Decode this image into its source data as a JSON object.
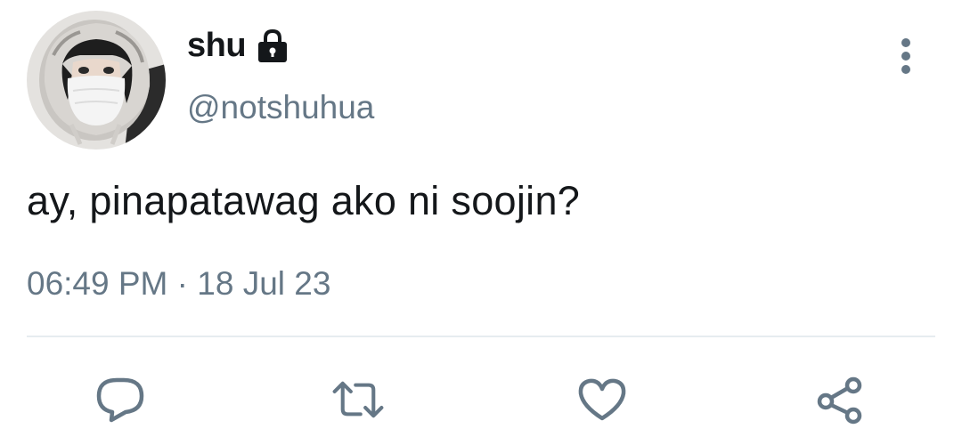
{
  "user": {
    "display_name": "shu",
    "handle": "@notshuhua",
    "protected": true,
    "avatar_icon": "profile-photo-masked-person"
  },
  "tweet": {
    "text": "ay, pinapatawag ako ni soojin?",
    "time": "06:49 PM",
    "separator": "·",
    "date": "18 Jul 23"
  },
  "actions": {
    "reply_icon": "reply-icon",
    "retweet_icon": "retweet-icon",
    "like_icon": "heart-icon",
    "share_icon": "share-icon"
  },
  "colors": {
    "text_primary": "#14171a",
    "text_secondary": "#657786",
    "divider": "#e6ecf0"
  }
}
